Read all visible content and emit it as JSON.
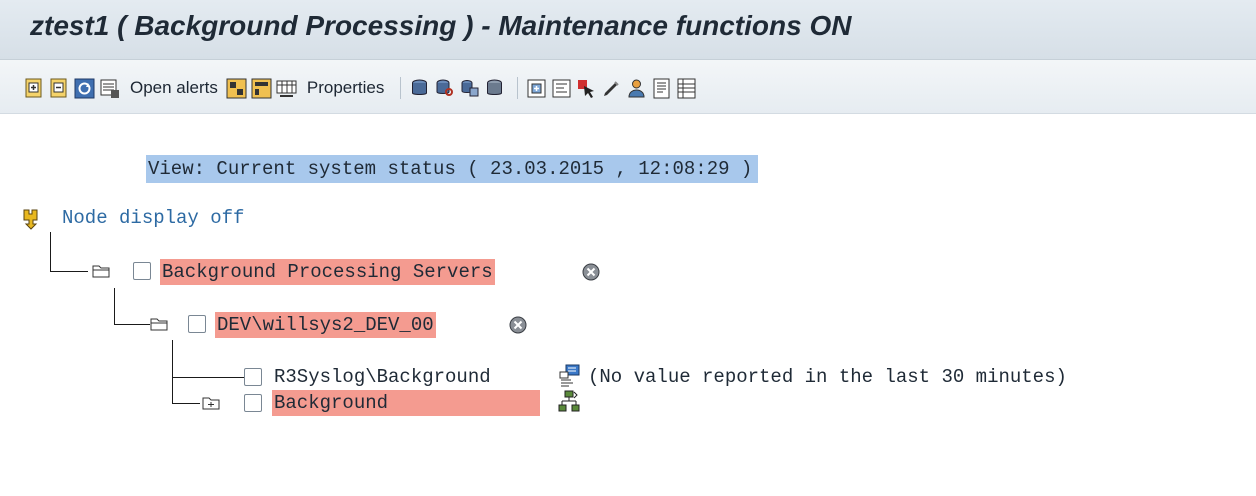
{
  "window": {
    "title": "ztest1 ( Background Processing ) - Maintenance functions ON"
  },
  "toolbar": {
    "open_alerts_label": "Open alerts",
    "properties_label": "Properties",
    "icons": [
      "expand-icon",
      "collapse-icon",
      "refresh-icon",
      "display-icon",
      "open-alerts",
      "layout-icon",
      "layout-alt-icon",
      "display-list-icon",
      "properties",
      "database-icon",
      "database-search-icon",
      "database-copy-icon",
      "database-alt-icon",
      "new-node-icon",
      "node-details-icon",
      "select-cursor-icon",
      "pen-icon",
      "user-icon",
      "report-icon",
      "list-icon"
    ]
  },
  "view": {
    "line": "View: Current system status ( 23.03.2015 , 12:08:29 )"
  },
  "tree": {
    "node_display_label": "Node display off",
    "nodes": [
      {
        "label": "Background Processing Servers",
        "status": "error"
      },
      {
        "label": "DEV\\willsys2_DEV_00",
        "status": "error"
      },
      {
        "label": "R3Syslog\\Background",
        "note": "(No value reported in the last 30 minutes)"
      },
      {
        "label": "Background",
        "status": "error"
      }
    ]
  },
  "colors": {
    "alert_highlight": "#f49b90",
    "selection": "#a8c8ec",
    "link": "#2d6aa3"
  }
}
